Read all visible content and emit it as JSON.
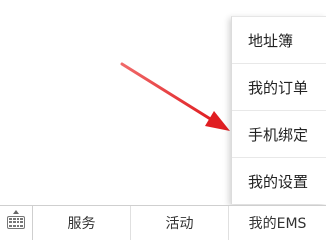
{
  "popup_menu": {
    "items": [
      {
        "label": "地址簿"
      },
      {
        "label": "我的订单"
      },
      {
        "label": "手机绑定"
      },
      {
        "label": "我的设置"
      }
    ]
  },
  "bottom_bar": {
    "keyboard_icon": "keyboard-toggle-icon",
    "tabs": [
      {
        "label": "服务"
      },
      {
        "label": "活动"
      },
      {
        "label": "我的EMS"
      }
    ]
  },
  "annotation": {
    "arrow_color": "#e8262a",
    "points_to": "手机绑定"
  }
}
